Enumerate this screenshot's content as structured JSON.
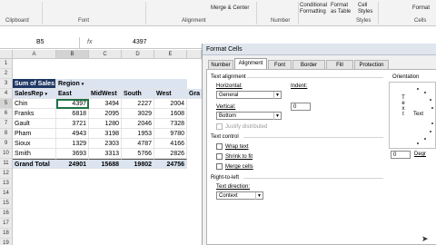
{
  "ribbon": {
    "groups": [
      "Clipboard",
      "Font",
      "Alignment",
      "Number",
      "Styles",
      "Cells"
    ],
    "merge_center": "Merge & Center",
    "conditional_formatting": "Conditional Formatting",
    "format_as_table": "Format as Table",
    "cell_styles": "Cell Styles",
    "format": "Format"
  },
  "formula_bar": {
    "name_box": "B5",
    "fx": "fx",
    "value": "4397"
  },
  "grid": {
    "columns": [
      "A",
      "B",
      "C",
      "D",
      "E"
    ],
    "rows": [
      "1",
      "2",
      "3",
      "4",
      "5",
      "6",
      "7",
      "8",
      "9",
      "10",
      "11",
      "12",
      "13",
      "14",
      "15",
      "16",
      "17",
      "18",
      "19"
    ],
    "pivot": {
      "title": "Sum of Sales",
      "region_label": "Region",
      "row_header": "SalesRep",
      "col_headers": [
        "East",
        "MidWest",
        "South",
        "West",
        "Gra"
      ],
      "reps": [
        {
          "name": "Chin",
          "values": [
            "4397",
            "3494",
            "2227",
            "2004"
          ]
        },
        {
          "name": "Franks",
          "values": [
            "6818",
            "2095",
            "3029",
            "1608"
          ]
        },
        {
          "name": "Gault",
          "values": [
            "3721",
            "1280",
            "2046",
            "7328"
          ]
        },
        {
          "name": "Pham",
          "values": [
            "4943",
            "3198",
            "1953",
            "9780"
          ]
        },
        {
          "name": "Sioux",
          "values": [
            "1329",
            "2303",
            "4787",
            "4166"
          ]
        },
        {
          "name": "Smith",
          "values": [
            "3693",
            "3313",
            "5766",
            "2826"
          ]
        }
      ],
      "total_label": "Grand Total",
      "totals": [
        "24901",
        "15688",
        "19802",
        "24756"
      ]
    }
  },
  "dialog": {
    "title": "Format Cells",
    "tabs": [
      "Number",
      "Alignment",
      "Font",
      "Border",
      "Fill",
      "Protection"
    ],
    "active_tab": "Alignment",
    "text_alignment": "Text alignment",
    "horizontal_label": "Horizontal:",
    "horizontal_value": "General",
    "indent_label": "Indent:",
    "indent_value": "0",
    "vertical_label": "Vertical:",
    "vertical_value": "Bottom",
    "justify_distributed": "Justify distributed",
    "text_control": "Text control",
    "wrap_text": "Wrap text",
    "shrink_to_fit": "Shrink to fit",
    "merge_cells": "Merge cells",
    "right_to_left": "Right-to-left",
    "text_direction_label": "Text direction:",
    "text_direction_value": "Context",
    "orientation": "Orientation",
    "orientation_vertical_text": "Text",
    "orientation_text": "Text",
    "degrees_value": "0",
    "degrees_label": "Degr"
  }
}
